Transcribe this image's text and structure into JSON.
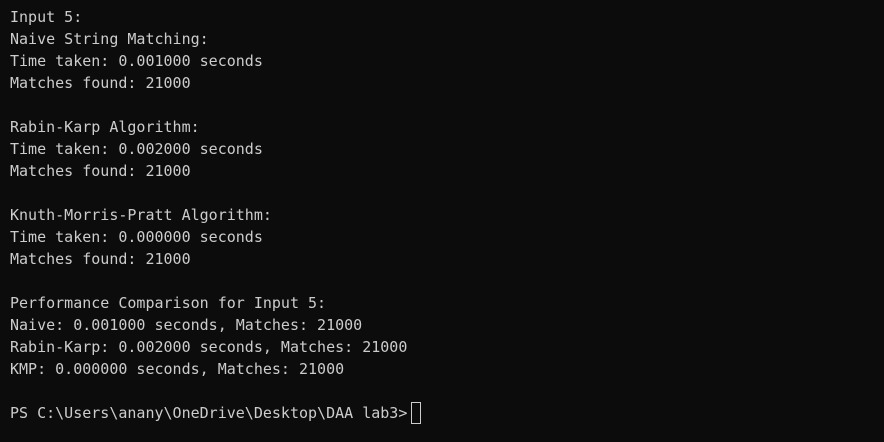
{
  "terminal": {
    "lines": [
      "Input 5:",
      "Naive String Matching:",
      "Time taken: 0.001000 seconds",
      "Matches found: 21000",
      "",
      "Rabin-Karp Algorithm:",
      "Time taken: 0.002000 seconds",
      "Matches found: 21000",
      "",
      "Knuth-Morris-Pratt Algorithm:",
      "Time taken: 0.000000 seconds",
      "Matches found: 21000",
      "",
      "Performance Comparison for Input 5:",
      "Naive: 0.001000 seconds, Matches: 21000",
      "Rabin-Karp: 0.002000 seconds, Matches: 21000",
      "KMP: 0.000000 seconds, Matches: 21000",
      ""
    ],
    "prompt": "PS C:\\Users\\anany\\OneDrive\\Desktop\\DAA lab3>",
    "colors": {
      "background": "#0c0c0c",
      "text": "#cccccc"
    }
  }
}
